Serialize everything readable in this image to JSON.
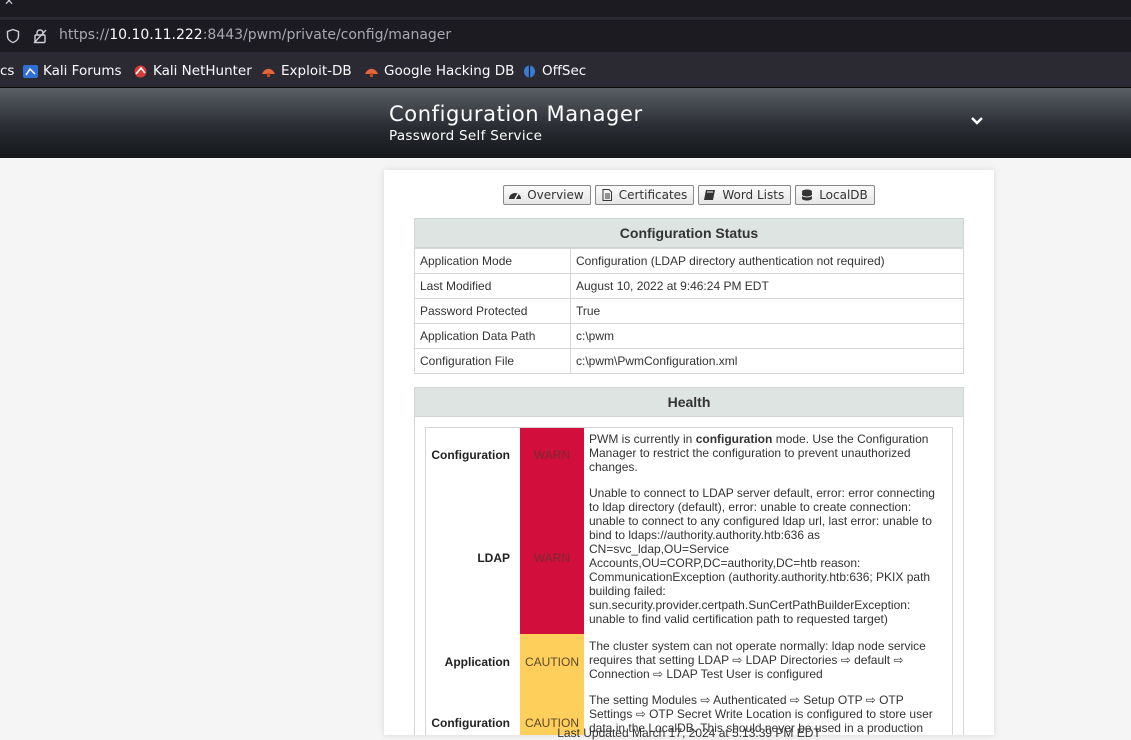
{
  "browser": {
    "url_scheme": "https://",
    "url_host": "10.10.11.222",
    "url_rest": ":8443/pwm/private/config/manager",
    "bookmarks": [
      {
        "label": "cs",
        "icon": "none"
      },
      {
        "label": "Kali Forums",
        "icon": "kali-forums-icon"
      },
      {
        "label": "Kali NetHunter",
        "icon": "kali-nethunter-icon"
      },
      {
        "label": "Exploit-DB",
        "icon": "exploit-db-icon"
      },
      {
        "label": "Google Hacking DB",
        "icon": "ghdb-icon"
      },
      {
        "label": "OffSec",
        "icon": "offsec-icon"
      }
    ]
  },
  "header": {
    "title": "Configuration Manager",
    "subtitle": "Password Self Service"
  },
  "nav": {
    "overview": "Overview",
    "certificates": "Certificates",
    "word_lists": "Word Lists",
    "localdb": "LocalDB"
  },
  "config_status": {
    "title": "Configuration Status",
    "rows": [
      {
        "key": "Application Mode",
        "value": "Configuration (LDAP directory authentication not required)"
      },
      {
        "key": "Last Modified",
        "value": "August 10, 2022 at 9:46:24 PM EDT"
      },
      {
        "key": "Password Protected",
        "value": "True"
      },
      {
        "key": "Application Data Path",
        "value": "c:\\pwm"
      },
      {
        "key": "Configuration File",
        "value": "c:\\pwm\\PwmConfiguration.xml"
      }
    ]
  },
  "health": {
    "title": "Health",
    "items": [
      {
        "topic": "Configuration",
        "status": "WARN",
        "detail_pre": "PWM is currently in ",
        "detail_bold": "configuration",
        "detail_post": " mode. Use the Configuration Manager to restrict the configuration to prevent unauthorized changes."
      },
      {
        "topic": "LDAP",
        "status": "WARN",
        "detail_pre": "Unable to connect to LDAP server default, error: error connecting to ldap directory (default), error: unable to create connection: unable to connect to any configured ldap url, last error: unable to bind to ldaps://authority.authority.htb:636 as CN=svc_ldap,OU=Service Accounts,OU=CORP,DC=authority,DC=htb reason: CommunicationException (authority.authority.htb:636; PKIX path building failed: sun.security.provider.certpath.SunCertPathBuilderException: unable to find valid certification path to requested target)",
        "detail_bold": "",
        "detail_post": ""
      },
      {
        "topic": "Application",
        "status": "CAUTION",
        "detail_pre": "The cluster system can not operate normally: ldap node service requires that setting LDAP ⇨ LDAP Directories ⇨ default ⇨ Connection ⇨ LDAP Test User is configured",
        "detail_bold": "",
        "detail_post": ""
      },
      {
        "topic": "Configuration",
        "status": "CAUTION",
        "detail_pre": "The setting Modules ⇨ Authenticated ⇨ Setup OTP ⇨ OTP Settings ⇨ OTP Secret Write Location is configured to store user data in the LocalDB. This should never be used in a production environment.",
        "detail_bold": "",
        "detail_post": ""
      }
    ]
  },
  "footer": {
    "last_updated": "Last Updated March 17, 2024 at 5:13:39 PM EDT"
  },
  "colors": {
    "warn": "#d20f3c",
    "caution": "#ffcf5c",
    "section_header": "#dde4e2"
  }
}
